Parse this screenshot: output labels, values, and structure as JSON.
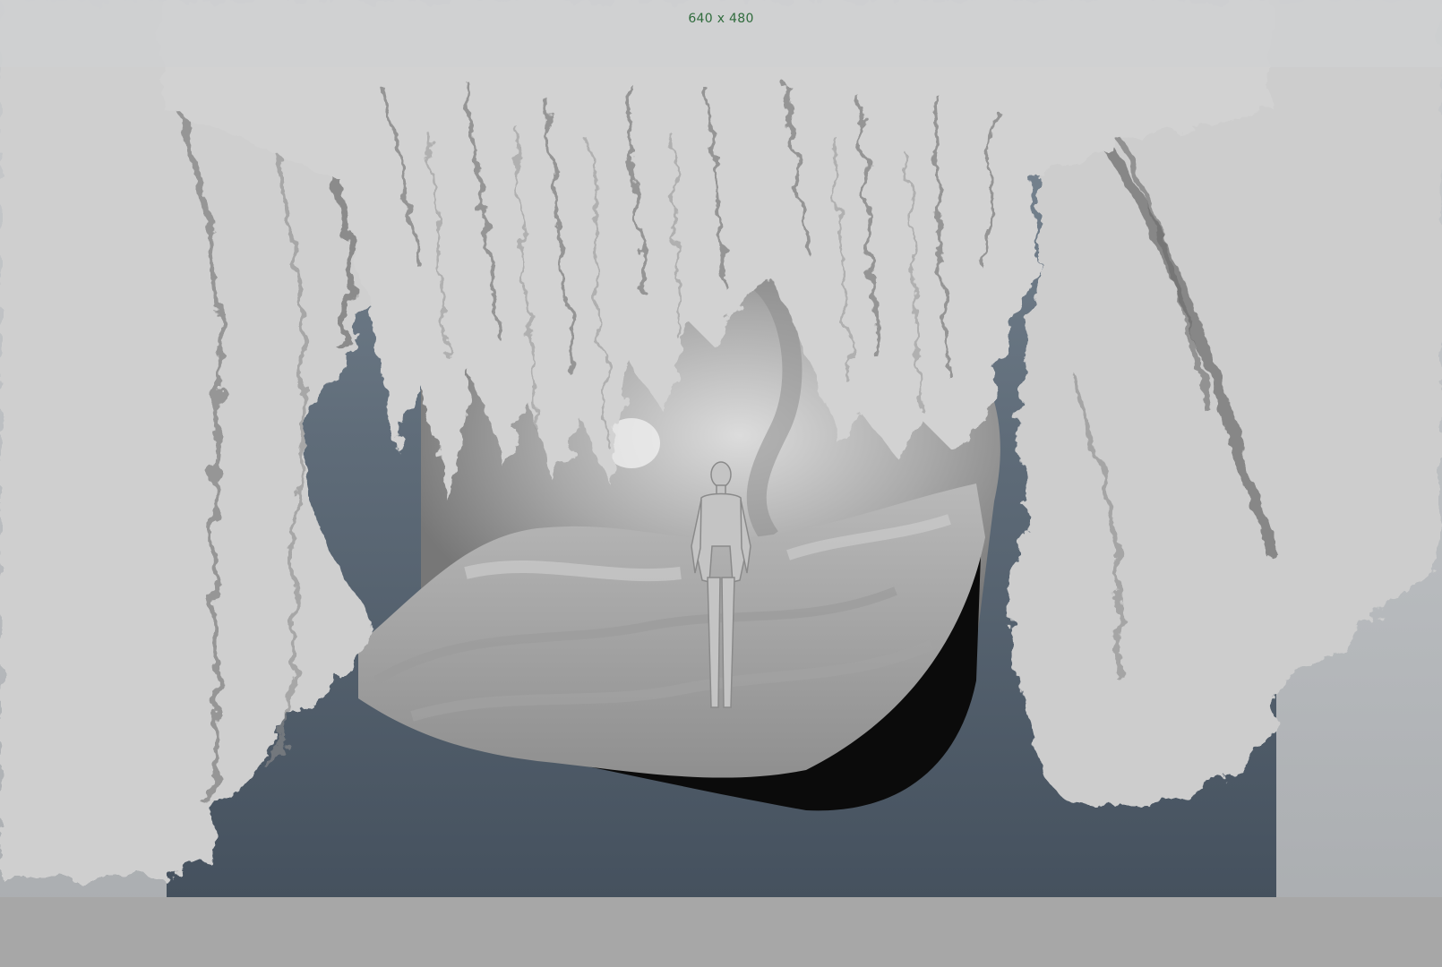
{
  "viewport": {
    "resolution_gate_label": "640 x 480"
  },
  "colors": {
    "background_top": "#c9cbcd",
    "gate_gradient_top": "#7c8995",
    "gate_gradient_bottom": "#45515e",
    "rock_light": "#d6d6d6",
    "rock_mid": "#b5b5b5",
    "rock_dark": "#6d6d6d",
    "shadow": "#0d0d0d",
    "label_green": "#2f6b3c"
  },
  "scene": {
    "objects": [
      {
        "name": "cave-ceiling-stalactites"
      },
      {
        "name": "cave-left-wall"
      },
      {
        "name": "cave-right-wall"
      },
      {
        "name": "cave-floor-terrain"
      },
      {
        "name": "human-scale-reference-figure"
      }
    ]
  }
}
